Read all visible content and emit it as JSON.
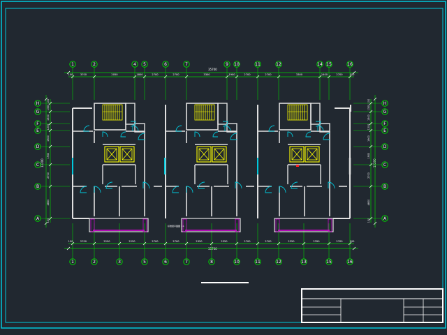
{
  "colors": {
    "background": "#212830",
    "frame": "#00c8dc",
    "wall": "#e0e0e0",
    "axis": "#00d000",
    "dimension": "#ffffff",
    "door": "#00c8dc",
    "stair": "#ffff00",
    "balcony": "#e000e0",
    "accent_red": "#ff2020"
  },
  "drawing": {
    "top_axes": [
      "1",
      "2",
      "4",
      "5",
      "6",
      "7",
      "9",
      "10",
      "11",
      "12",
      "14",
      "15",
      "16"
    ],
    "bottom_axes": [
      "1",
      "2",
      "3",
      "5",
      "6",
      "7",
      "8",
      "10",
      "11",
      "12",
      "13",
      "15",
      "16"
    ],
    "row_axes": [
      "H",
      "G",
      "F",
      "E",
      "D",
      "C",
      "B",
      "A"
    ],
    "overall_dimension_top": "35700",
    "overall_dimension_bottom": "35700",
    "top_dimension_segments": [
      "100",
      "3700",
      "2050",
      "1800",
      "2700",
      "2700",
      "3300",
      "1900",
      "2700",
      "2700",
      "3300",
      "1400",
      "2700",
      "100"
    ],
    "bottom_dimension_segments": [
      "100",
      "2700",
      "2250",
      "2250",
      "2700",
      "2700",
      "2350",
      "2350",
      "2700",
      "2700",
      "2350",
      "2350",
      "2700",
      "100"
    ],
    "left_dimension_segments": [
      "100",
      "1300",
      "1500",
      "1200",
      "1600",
      "1900",
      "2700",
      "4800",
      "100"
    ],
    "left_overall": "13200",
    "right_dimension_segments": [
      "100",
      "1300",
      "1500",
      "1200",
      "1600",
      "1900",
      "2700",
      "4800",
      "100"
    ],
    "right_overall": "13200",
    "plan_label": "标准层平面图 1:1"
  },
  "title_block": {
    "rows": 3
  }
}
